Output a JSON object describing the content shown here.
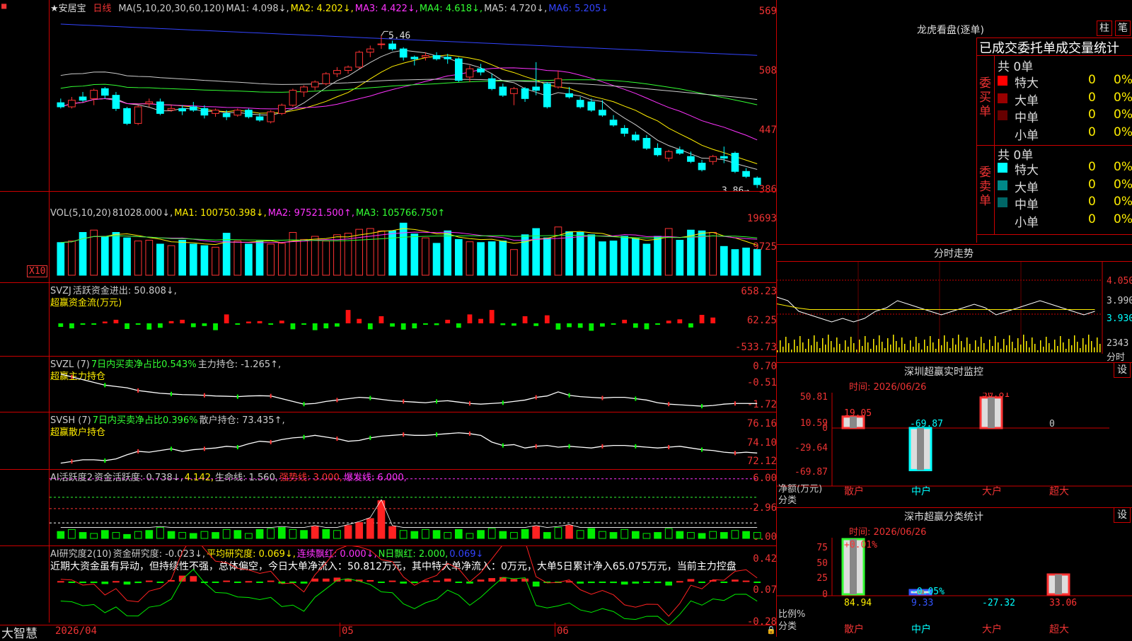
{
  "main_chart": {
    "flag": "■",
    "stock_name": "★安居宝",
    "period": "日线",
    "ma_legend": [
      {
        "text": "MA(5,10,20,30,60,120)",
        "color": "#cccccc"
      },
      {
        "text": "MA1: 4.098↓,",
        "color": "#cccccc"
      },
      {
        "text": "MA2: 4.202↓,",
        "color": "#ffee00"
      },
      {
        "text": "MA3: 4.422↓,",
        "color": "#ff33ff"
      },
      {
        "text": "MA4: 4.618↓,",
        "color": "#33ff33"
      },
      {
        "text": "MA5: 4.720↓,",
        "color": "#cccccc"
      },
      {
        "text": "MA6: 5.205↓",
        "color": "#3344ff"
      }
    ],
    "y_labels": [
      "569",
      "508",
      "447",
      "386"
    ],
    "high_mark": "5.46",
    "low_mark": "3.86→"
  },
  "vol_chart": {
    "legend": [
      {
        "text": "VOL(5,10,20)",
        "color": "#cccccc"
      },
      {
        "text": "81028.000↓,",
        "color": "#cccccc"
      },
      {
        "text": "MA1: 100750.398↓,",
        "color": "#ffee00"
      },
      {
        "text": "MA2: 97521.500↑,",
        "color": "#ff33ff"
      },
      {
        "text": "MA3: 105766.750↑",
        "color": "#33ff33"
      }
    ],
    "y_labels": [
      "19693",
      "9725"
    ],
    "unit_label": "X10"
  },
  "svzj_chart": {
    "legend": [
      {
        "text": "SVZJ",
        "color": "#cccccc"
      },
      {
        "text": "活跃资金进出: 50.808↓,",
        "color": "#cccccc"
      }
    ],
    "sub_title": "超赢资金流(万元)",
    "y_labels": [
      "658.23",
      "62.25",
      "-533.73"
    ]
  },
  "svzl_chart": {
    "legend": [
      {
        "text": "SVZL (7)",
        "color": "#cccccc"
      },
      {
        "text": "7日内买卖净占比0.543%",
        "color": "#33ff33"
      },
      {
        "text": "主力持仓: -1.265↑,",
        "color": "#cccccc"
      }
    ],
    "sub_title": "超赢主力持仓",
    "y_labels": [
      "0.70",
      "-0.51",
      "-1.72"
    ]
  },
  "svsh_chart": {
    "legend": [
      {
        "text": "SVSH (7)",
        "color": "#cccccc"
      },
      {
        "text": "7日内买卖净占比0.396%",
        "color": "#33ff33"
      },
      {
        "text": "散户持仓: 73.435↑,",
        "color": "#cccccc"
      }
    ],
    "sub_title": "超赢散户持仓",
    "y_labels": [
      "76.16",
      "74.10",
      "72.12"
    ]
  },
  "ai_active_chart": {
    "legend": [
      {
        "text": "AI活跃度2",
        "color": "#cccccc"
      },
      {
        "text": "资金活跃度: 0.738↓,",
        "color": "#cccccc"
      },
      {
        "text": "4.142,",
        "color": "#ffee00"
      },
      {
        "text": "生命线: 1.560,",
        "color": "#cccccc"
      },
      {
        "text": "强势线: 3.000,",
        "color": "#ff3333"
      },
      {
        "text": "爆发线: 6.000,",
        "color": "#ff33ff"
      }
    ],
    "y_labels": [
      "6.00",
      "2.96",
      "0.00"
    ]
  },
  "ai_research_chart": {
    "legend": [
      {
        "text": "AI研究度2(10)",
        "color": "#cccccc"
      },
      {
        "text": "资金研究度: -0.023↓,",
        "color": "#cccccc"
      },
      {
        "text": "平均研究度: 0.069↓,",
        "color": "#ffee00"
      },
      {
        "text": "连续飘红: 0.000↓,",
        "color": "#ff33ff"
      },
      {
        "text": "N日飘红: 2.000,",
        "color": "#33ff33"
      },
      {
        "text": "0.069↓",
        "color": "#3344ff"
      }
    ],
    "commentary": "近期大资金虽有异动，但持续性不强，总体偏空，今日大单净流入：50.812万元，其中特大单净流入：0万元，大单5日累计净入65.075万元，当前主力控盘",
    "y_labels": [
      "0.42",
      "0.07",
      "-0.28"
    ]
  },
  "x_axis": {
    "labels": [
      "2026/04",
      "05",
      "06"
    ],
    "brand": "大智慧"
  },
  "right_panel": {
    "dragon_title": "龙虎看盘(逐单)",
    "btn_column": "柱",
    "btn_stroke": "笔",
    "order_title": "已成交委托单成交量统计",
    "buy_label": "委买单",
    "sell_label": "委卖单",
    "buy_total": "共 0单",
    "sell_total": "共 0单",
    "buy_rows": [
      {
        "label": "特大",
        "value": "0",
        "pct": "0%",
        "color": "#ff0000"
      },
      {
        "label": "大单",
        "value": "0",
        "pct": "0%",
        "color": "#990000"
      },
      {
        "label": "中单",
        "value": "0",
        "pct": "0%",
        "color": "#660000"
      },
      {
        "label": "小单",
        "value": "0",
        "pct": "0%",
        "color": ""
      }
    ],
    "sell_rows": [
      {
        "label": "特大",
        "value": "0",
        "pct": "0%",
        "color": "#00ffff"
      },
      {
        "label": "大单",
        "value": "0",
        "pct": "0%",
        "color": "#008888"
      },
      {
        "label": "中单",
        "value": "0",
        "pct": "0%",
        "color": "#006666"
      },
      {
        "label": "小单",
        "value": "0",
        "pct": "0%",
        "color": ""
      }
    ],
    "intraday_title": "分时走势",
    "intraday_y": [
      "4.050",
      "3.990",
      "3.930"
    ],
    "intraday_vol": "2343",
    "intraday_label": "分时",
    "monitor_title": "深圳超赢实时监控",
    "monitor_btn": "设",
    "monitor_time": "时间: 2026/06/26",
    "monitor_y": [
      "50.81",
      "10.59",
      "0",
      "-29.64",
      "-69.87"
    ],
    "monitor_unit": "净额(万元)",
    "monitor_cat_label": "分类",
    "monitor_bars": [
      {
        "cat": "散户",
        "value": "19.05",
        "color": "#ff3333"
      },
      {
        "cat": "中户",
        "value": "-69.87",
        "color": "#00ffff"
      },
      {
        "cat": "大户",
        "value": "50.81",
        "color": "#ff3333"
      },
      {
        "cat": "超大",
        "value": "0",
        "color": "#cccccc"
      }
    ],
    "stat_title": "深市超赢分类统计",
    "stat_btn": "设",
    "stat_time": "时间: 2026/06/26",
    "stat_y": [
      "75",
      "50",
      "25",
      "0"
    ],
    "stat_unit": "比例%",
    "stat_cat_label": "分类",
    "stat_top": [
      {
        "text": "+0.01%",
        "color": "#ff3333"
      },
      {
        "text": "-0.05%",
        "color": "#00ffff"
      }
    ],
    "stat_bars": [
      {
        "cat": "散户",
        "value": "84.94",
        "color": "#ffee00"
      },
      {
        "cat": "中户",
        "value": "9.33",
        "color": "#3355ff"
      },
      {
        "cat": "大户",
        "value": "-27.32",
        "color": "#00ffff"
      },
      {
        "cat": "超大",
        "value": "33.06",
        "color": "#ff3333"
      }
    ]
  },
  "chart_data": {
    "type": "bar",
    "candles": [
      [
        4.65,
        4.7,
        4.58,
        4.6
      ],
      [
        4.6,
        4.72,
        4.58,
        4.68
      ],
      [
        4.72,
        4.78,
        4.66,
        4.68
      ],
      [
        4.7,
        4.82,
        4.62,
        4.8
      ],
      [
        4.82,
        4.84,
        4.7,
        4.74
      ],
      [
        4.74,
        4.78,
        4.55,
        4.58
      ],
      [
        4.58,
        4.6,
        4.38,
        4.4
      ],
      [
        4.4,
        4.62,
        4.38,
        4.6
      ],
      [
        4.64,
        4.7,
        4.6,
        4.66
      ],
      [
        4.66,
        4.7,
        4.5,
        4.52
      ],
      [
        4.56,
        4.62,
        4.54,
        4.58
      ],
      [
        4.58,
        4.62,
        4.5,
        4.55
      ],
      [
        4.6,
        4.66,
        4.54,
        4.56
      ],
      [
        4.58,
        4.62,
        4.46,
        4.5
      ],
      [
        4.52,
        4.58,
        4.48,
        4.56
      ],
      [
        4.52,
        4.56,
        4.44,
        4.48
      ],
      [
        4.5,
        4.58,
        4.48,
        4.56
      ],
      [
        4.56,
        4.58,
        4.46,
        4.48
      ],
      [
        4.48,
        4.52,
        4.42,
        4.44
      ],
      [
        4.42,
        4.56,
        4.4,
        4.54
      ],
      [
        4.52,
        4.64,
        4.5,
        4.62
      ],
      [
        4.62,
        4.82,
        4.6,
        4.8
      ],
      [
        4.78,
        4.86,
        4.72,
        4.84
      ],
      [
        4.84,
        4.92,
        4.8,
        4.9
      ],
      [
        4.88,
        5.02,
        4.86,
        5.0
      ],
      [
        5.0,
        5.08,
        4.96,
        5.04
      ],
      [
        5.04,
        5.1,
        5.0,
        5.08
      ],
      [
        5.08,
        5.28,
        5.06,
        5.26
      ],
      [
        5.26,
        5.34,
        5.2,
        5.3
      ],
      [
        5.36,
        5.46,
        5.3,
        5.36
      ],
      [
        5.36,
        5.4,
        5.28,
        5.3
      ],
      [
        5.3,
        5.32,
        5.16,
        5.2
      ],
      [
        5.2,
        5.22,
        5.1,
        5.18
      ],
      [
        5.2,
        5.26,
        5.16,
        5.22
      ],
      [
        5.22,
        5.26,
        5.16,
        5.18
      ],
      [
        5.2,
        5.24,
        5.12,
        5.18
      ],
      [
        5.18,
        5.2,
        4.9,
        4.92
      ],
      [
        4.96,
        5.1,
        4.9,
        5.06
      ],
      [
        5.06,
        5.12,
        4.98,
        5.02
      ],
      [
        4.94,
        5.0,
        4.8,
        4.82
      ],
      [
        4.84,
        4.88,
        4.72,
        4.74
      ],
      [
        4.76,
        4.84,
        4.62,
        4.82
      ],
      [
        4.82,
        4.84,
        4.66,
        4.7
      ],
      [
        4.84,
        5.14,
        4.74,
        4.8
      ],
      [
        4.88,
        4.9,
        4.58,
        4.6
      ],
      [
        4.84,
        5.04,
        4.82,
        4.94
      ],
      [
        4.76,
        4.84,
        4.7,
        4.72
      ],
      [
        4.68,
        4.72,
        4.58,
        4.6
      ],
      [
        4.66,
        4.7,
        4.54,
        4.56
      ],
      [
        4.56,
        4.68,
        4.48,
        4.5
      ],
      [
        4.44,
        4.5,
        4.36,
        4.38
      ],
      [
        4.34,
        4.38,
        4.24,
        4.28
      ],
      [
        4.26,
        4.3,
        4.18,
        4.2
      ],
      [
        4.22,
        4.26,
        4.08,
        4.1
      ],
      [
        4.1,
        4.16,
        4.0,
        4.02
      ],
      [
        3.98,
        4.08,
        3.94,
        4.06
      ],
      [
        4.08,
        4.12,
        4.02,
        4.04
      ],
      [
        4.0,
        4.06,
        3.92,
        3.94
      ],
      [
        3.92,
        3.96,
        3.82,
        3.84
      ],
      [
        3.94,
        4.02,
        3.9,
        4.0
      ],
      [
        4.0,
        4.12,
        3.92,
        3.98
      ],
      [
        4.04,
        4.06,
        3.8,
        3.82
      ],
      [
        3.82,
        3.86,
        3.74,
        3.76
      ],
      [
        3.74,
        3.76,
        3.62,
        3.66
      ]
    ],
    "volume": [
      42,
      44,
      55,
      58,
      50,
      55,
      48,
      44,
      45,
      40,
      38,
      45,
      40,
      38,
      36,
      54,
      44,
      40,
      44,
      40,
      41,
      55,
      46,
      50,
      44,
      52,
      54,
      59,
      60,
      57,
      57,
      67,
      53,
      48,
      41,
      57,
      46,
      43,
      42,
      43,
      44,
      33,
      52,
      60,
      48,
      62,
      56,
      55,
      52,
      43,
      44,
      50,
      47,
      40,
      50,
      60,
      45,
      58,
      57,
      55,
      37,
      33,
      35,
      33
    ],
    "svzj": [
      -120,
      -170,
      -30,
      -30,
      -40,
      -80,
      -190,
      -40,
      -210,
      -150,
      -50,
      -80,
      -130,
      -90,
      -230,
      -200,
      -30,
      -40,
      -50,
      -40,
      -60,
      -200,
      -20,
      -230,
      -170,
      -110,
      -300,
      -100,
      -200,
      -160,
      -110,
      -210,
      -170,
      -30,
      -60,
      -80,
      -150,
      -200,
      -100,
      -300,
      -60,
      -80,
      -160,
      -90,
      -180,
      -210,
      -130,
      -150,
      -250,
      -110,
      -30,
      -80,
      -150,
      -200,
      -50,
      -60,
      -90,
      -140,
      -190,
      -130
    ],
    "svzj_signs": [
      -1,
      -1,
      -1,
      -1,
      1,
      1,
      -1,
      -1,
      -1,
      -1,
      1,
      1,
      -1,
      -1,
      -1,
      1,
      -1,
      1,
      1,
      -1,
      1,
      -1,
      -1,
      -1,
      -1,
      -1,
      1,
      1,
      -1,
      1,
      -1,
      -1,
      -1,
      -1,
      -1,
      1,
      -1,
      1,
      1,
      1,
      -1,
      -1,
      1,
      -1,
      1,
      -1,
      -1,
      -1,
      -1,
      -1,
      -1,
      1,
      -1,
      -1,
      -1,
      1,
      1,
      -1,
      1,
      1
    ],
    "svzl": [
      0.72,
      0.5,
      0.3,
      0.1,
      -0.1,
      -0.2,
      -0.3,
      -0.5,
      -0.6,
      -0.7,
      -0.75,
      -0.8,
      -0.82,
      -0.85,
      -0.9,
      -0.92,
      -0.95,
      -0.9,
      -0.88,
      -0.9,
      -1.1,
      -1.3,
      -1.5,
      -1.45,
      -1.3,
      -1.2,
      -1.1,
      -1.0,
      -1.05,
      -1.15,
      -1.25,
      -1.3,
      -1.35,
      -1.4,
      -1.3,
      -1.25,
      -1.35,
      -1.45,
      -1.5,
      -1.45,
      -1.4,
      -1.3,
      -1.2,
      -1.0,
      -0.9,
      -0.6,
      -0.85,
      -0.95,
      -1.0,
      -1.05,
      -1.0,
      -1.0,
      -1.1,
      -1.2,
      -1.4,
      -1.5,
      -1.55,
      -1.6,
      -1.65,
      -1.6,
      -1.5,
      -1.45,
      -1.45,
      -1.46
    ],
    "svsh": [
      72.2,
      72.4,
      72.6,
      72.6,
      72.5,
      72.7,
      73.2,
      73.6,
      73.5,
      73.7,
      73.9,
      73.6,
      73.8,
      73.9,
      74.0,
      74.2,
      74.1,
      74.5,
      74.8,
      74.7,
      75.0,
      75.2,
      75.3,
      75.5,
      75.3,
      75.1,
      74.8,
      74.9,
      75.2,
      75.4,
      75.5,
      75.6,
      75.5,
      75.5,
      75.6,
      75.7,
      75.8,
      75.7,
      75.5,
      74.7,
      74.3,
      74.4,
      74.0,
      74.2,
      74.3,
      74.1,
      74.2,
      74.1,
      74.0,
      74.2,
      74.3,
      74.3,
      74.2,
      74.1,
      74.0,
      74.1,
      74.2,
      74.0,
      73.8,
      73.7,
      73.5,
      73.4,
      73.5,
      73.4
    ],
    "ai_active": [
      0.7,
      0.9,
      0.6,
      0.5,
      0.8,
      0.6,
      0.4,
      0.7,
      0.8,
      1.1,
      0.7,
      0.6,
      0.5,
      0.7,
      0.6,
      0.9,
      0.8,
      0.5,
      0.9,
      1.0,
      1.1,
      0.9,
      0.8,
      1.2,
      0.9,
      0.8,
      1.3,
      1.6,
      2.0,
      3.8,
      1.2,
      0.8,
      0.7,
      0.9,
      0.8,
      0.6,
      0.9,
      0.5,
      0.8,
      1.0,
      0.7,
      0.6,
      0.9,
      1.2,
      0.6,
      1.1,
      1.3,
      0.8,
      1.0,
      0.7,
      0.6,
      0.9,
      0.7,
      0.5,
      0.6,
      1.0,
      0.7,
      0.6,
      0.5,
      0.7,
      0.6,
      0.8,
      0.7,
      0.6
    ],
    "ai_research": [
      0.01,
      0.0,
      -0.02,
      0.0,
      -0.05,
      0.01,
      -0.06,
      -0.03,
      0.02,
      0.0,
      0.03,
      0.12,
      0.11,
      0.0,
      -0.01,
      0.02,
      0.0,
      0.01,
      0.0,
      0.02,
      -0.04,
      0.0,
      -0.04,
      0.06,
      0.06,
      0.08,
      0.06,
      0.04,
      0.03,
      0.0,
      0.02,
      -0.04,
      -0.03,
      0.02,
      0.02,
      0.06,
      0.0,
      -0.04,
      0.04,
      0.07,
      0.09,
      0.05,
      0.06,
      -0.1,
      -0.02,
      0.0,
      0.01,
      -0.04,
      -0.03,
      0.0,
      -0.03,
      -0.06,
      -0.04,
      -0.02,
      -0.03,
      -0.08,
      0.01,
      0.05,
      -0.02,
      0.03,
      0.0,
      0.04,
      0.02,
      -0.02
    ],
    "intraday": [
      3.99,
      3.98,
      3.95,
      3.94,
      3.93,
      3.92,
      3.93,
      3.92,
      3.93,
      3.95,
      3.96,
      3.98,
      3.97,
      3.96,
      3.95,
      3.94,
      3.95,
      3.96,
      3.97,
      3.96,
      3.94,
      3.95,
      3.96,
      3.97,
      3.98,
      3.97,
      3.96,
      3.95,
      3.94,
      3.95
    ]
  }
}
